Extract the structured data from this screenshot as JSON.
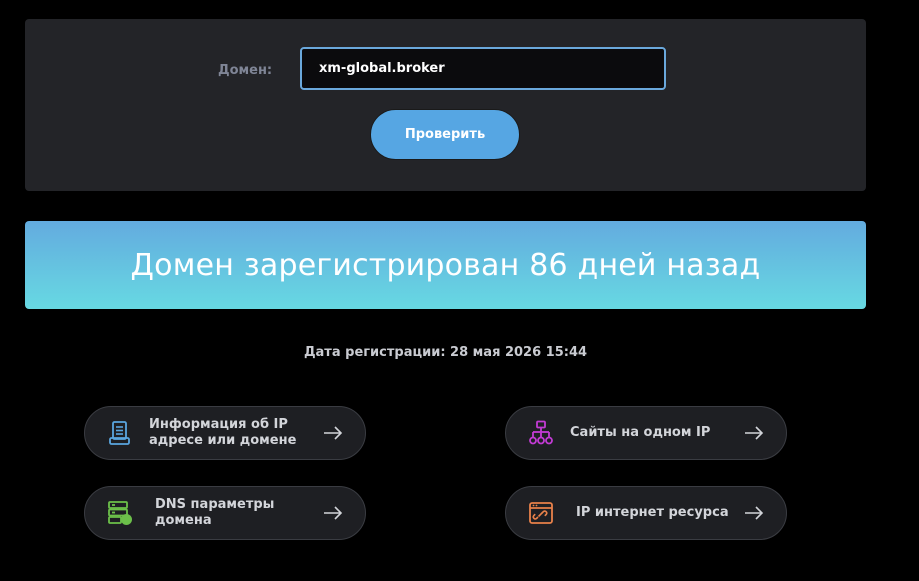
{
  "search": {
    "label": "Домен:",
    "value": "xm-global.broker",
    "button_label": "Проверить"
  },
  "banner": {
    "text": "Домен зарегистрирован 86 дней назад"
  },
  "registration": {
    "text": "Дата регистрации: 28 мая 2026 15:44"
  },
  "tools": [
    {
      "label": "Информация об IP адресе или домене",
      "icon": "document-icon",
      "color": "#5aa6e0"
    },
    {
      "label": "Сайты на одном IP",
      "icon": "sitemap-icon",
      "color": "#c23bd4"
    },
    {
      "label": "DNS параметры домена",
      "icon": "server-icon",
      "color": "#6cc04a"
    },
    {
      "label": "IP интернет ресурса",
      "icon": "browser-link-icon",
      "color": "#e8814a"
    }
  ],
  "colors": {
    "accent": "#56a6e3",
    "banner_top": "#63abdf",
    "banner_bottom": "#67d9e2"
  }
}
